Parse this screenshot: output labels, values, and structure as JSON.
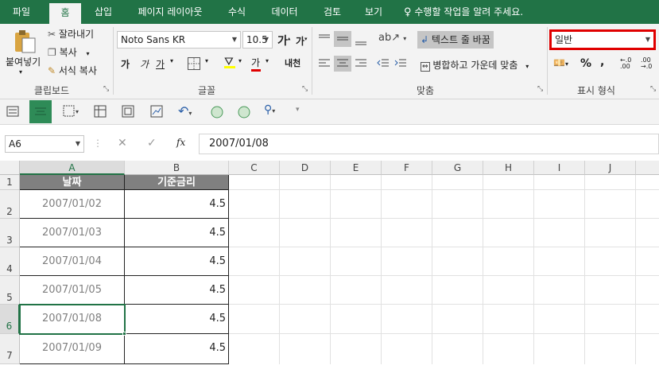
{
  "tabs": [
    {
      "label": "파일",
      "active": false
    },
    {
      "label": "홈",
      "active": true
    },
    {
      "label": "삽입",
      "active": false
    },
    {
      "label": "페이지 레이아웃",
      "active": false
    },
    {
      "label": "수식",
      "active": false
    },
    {
      "label": "데이터",
      "active": false
    },
    {
      "label": "검토",
      "active": false
    },
    {
      "label": "보기",
      "active": false
    }
  ],
  "tell_me": "수행할 작업을 알려 주세요.",
  "clipboard": {
    "paste": "붙여넣기",
    "cut": "잘라내기",
    "copy": "복사",
    "format_painter": "서식 복사",
    "group": "클립보드"
  },
  "font": {
    "name": "Noto Sans KR",
    "size": "10.5",
    "grow": "가",
    "shrink": "가",
    "bold": "가",
    "italic": "가",
    "underline": "가",
    "font_color": "가",
    "phonetic": "내천",
    "group": "글꼴"
  },
  "alignment": {
    "wrap_text": "텍스트 줄 바꿈",
    "merge_center": "병합하고 가운데 맞춤",
    "group": "맞춤"
  },
  "number": {
    "format": "일반",
    "percent": "%",
    "comma": ",",
    "group": "표시 형식"
  },
  "formula_bar": {
    "name_box": "A6",
    "fx": "fx",
    "content": "2007/01/08"
  },
  "columns": [
    "A",
    "B",
    "C",
    "D",
    "E",
    "F",
    "G",
    "H",
    "I",
    "J"
  ],
  "rows": [
    "1",
    "2",
    "3",
    "4",
    "5",
    "6",
    "7"
  ],
  "table": {
    "headers": [
      "날짜",
      "기준금리"
    ],
    "rows": [
      [
        "2007/01/02",
        "4.5"
      ],
      [
        "2007/01/03",
        "4.5"
      ],
      [
        "2007/01/04",
        "4.5"
      ],
      [
        "2007/01/05",
        "4.5"
      ],
      [
        "2007/01/08",
        "4.5"
      ],
      [
        "2007/01/09",
        "4.5"
      ]
    ]
  },
  "colors": {
    "accent": "#217346",
    "highlight_box": "#e00000",
    "header_fill": "#808080",
    "date_text": "#7f7f7f"
  }
}
